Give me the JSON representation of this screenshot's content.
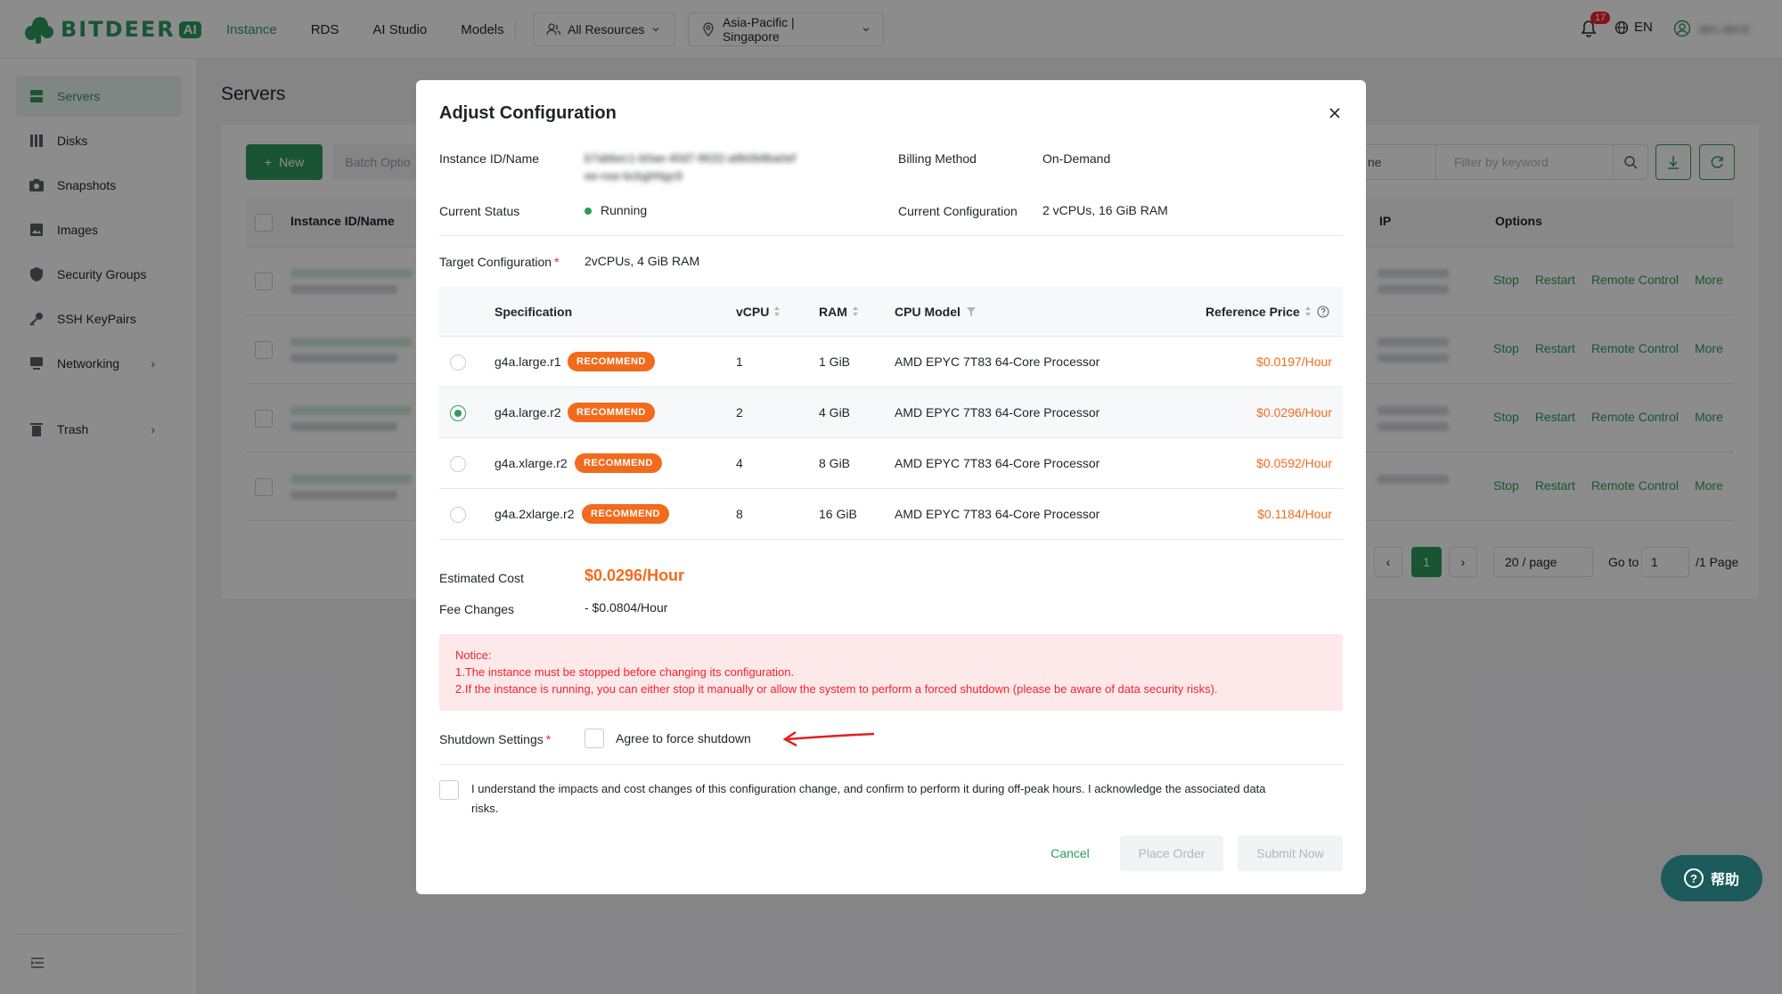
{
  "brand": {
    "name": "BITDEER",
    "ai_tag": "AI",
    "color": "#2e9b5b"
  },
  "topnav": {
    "items": [
      {
        "label": "Instance",
        "active": true
      },
      {
        "label": "RDS",
        "active": false
      },
      {
        "label": "AI Studio",
        "active": false
      },
      {
        "label": "Models",
        "active": false
      }
    ],
    "resource_select": "All Resources",
    "region_select": "Asia-Pacific | Singapore",
    "notification_count": "17",
    "language": "EN",
    "username": "abc.abcd"
  },
  "sidebar": {
    "items": [
      {
        "label": "Servers",
        "icon": "server-icon",
        "active": true
      },
      {
        "label": "Disks",
        "icon": "disk-icon"
      },
      {
        "label": "Snapshots",
        "icon": "camera-icon"
      },
      {
        "label": "Images",
        "icon": "image-icon"
      },
      {
        "label": "Security Groups",
        "icon": "shield-icon"
      },
      {
        "label": "SSH KeyPairs",
        "icon": "key-icon"
      },
      {
        "label": "Networking",
        "icon": "network-icon",
        "expandable": true
      },
      {
        "label": "Trash",
        "icon": "trash-icon",
        "expandable": true
      }
    ]
  },
  "page": {
    "title": "Servers",
    "new_button": "New",
    "batch_button": "Batch Optio",
    "filter_select": "ne",
    "filter_placeholder": "Filter by keyword",
    "table_headers": {
      "name": "Instance ID/Name",
      "ip": "IP",
      "options": "Options"
    },
    "row_actions": [
      "Stop",
      "Restart",
      "Remote Control",
      "More"
    ],
    "pagination": {
      "current": "1",
      "page_size": "20 / page",
      "goto_label": "Go to",
      "goto_value": "1",
      "total_label": "/1 Page"
    }
  },
  "modal": {
    "title": "Adjust Configuration",
    "instance_label": "Instance ID/Name",
    "instance_value_line1": "b7abbec1-b0ae-40d7-8632-a8b0b8ba0ef",
    "instance_value_line2": "ee-nse-bcbghNgc9",
    "billing_label": "Billing Method",
    "billing_value": "On-Demand",
    "status_label": "Current Status",
    "status_value": "Running",
    "current_config_label": "Current Configuration",
    "current_config_value": "2 vCPUs, 16 GiB RAM",
    "target_label": "Target Configuration",
    "target_value": "2vCPUs, 4 GiB RAM",
    "table_headers": {
      "spec": "Specification",
      "vcpu": "vCPU",
      "ram": "RAM",
      "cpu_model": "CPU Model",
      "price": "Reference Price"
    },
    "recommend_tag": "RECOMMEND",
    "rows": [
      {
        "spec": "g4a.large.r1",
        "vcpu": "1",
        "ram": "1 GiB",
        "cpu": "AMD EPYC 7T83 64-Core Processor",
        "price": "$0.0197/Hour",
        "selected": false
      },
      {
        "spec": "g4a.large.r2",
        "vcpu": "2",
        "ram": "4 GiB",
        "cpu": "AMD EPYC 7T83 64-Core Processor",
        "price": "$0.0296/Hour",
        "selected": true
      },
      {
        "spec": "g4a.xlarge.r2",
        "vcpu": "4",
        "ram": "8 GiB",
        "cpu": "AMD EPYC 7T83 64-Core Processor",
        "price": "$0.0592/Hour",
        "selected": false
      },
      {
        "spec": "g4a.2xlarge.r2",
        "vcpu": "8",
        "ram": "16 GiB",
        "cpu": "AMD EPYC 7T83 64-Core Processor",
        "price": "$0.1184/Hour",
        "selected": false
      }
    ],
    "estimated_cost_label": "Estimated Cost",
    "estimated_cost_value": "$0.0296/Hour",
    "fee_changes_label": "Fee Changes",
    "fee_changes_value": "- $0.0804/Hour",
    "notice_title": "Notice:",
    "notice_line1": "1.The instance must be stopped before changing its configuration.",
    "notice_line2": "2.If the instance is running, you can either stop it manually or allow the system to perform a forced shutdown (please be aware of data security risks).",
    "shutdown_label": "Shutdown Settings",
    "force_shutdown_label": "Agree to force shutdown",
    "acknowledge_line1": "I understand the impacts and cost changes of this configuration change, and confirm to perform it during off-peak hours. I acknowledge the associated data",
    "acknowledge_line2": "risks.",
    "cancel_button": "Cancel",
    "place_order_button": "Place Order",
    "submit_button": "Submit Now"
  },
  "help": {
    "label": "帮助"
  },
  "colors": {
    "accent": "#2e9b5b",
    "price": "#f26b1d",
    "danger": "#f5222d",
    "annotation_arrow": "#e02020"
  }
}
